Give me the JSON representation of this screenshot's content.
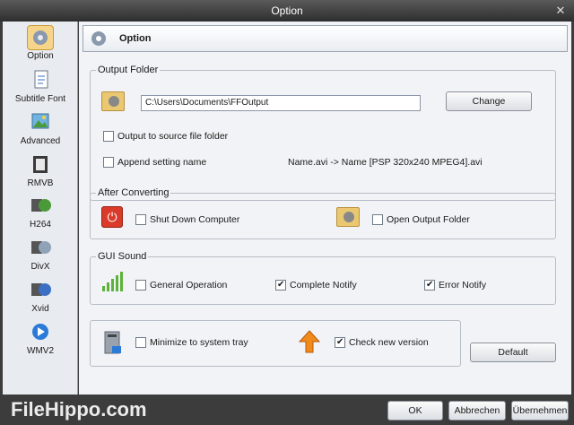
{
  "window": {
    "title": "Option",
    "close_glyph": "✕"
  },
  "sidebar": {
    "items": [
      {
        "label": "Option",
        "icon": "option-icon"
      },
      {
        "label": "Subtitle Font",
        "icon": "subtitle-font-icon"
      },
      {
        "label": "Advanced",
        "icon": "advanced-icon"
      },
      {
        "label": "RMVB",
        "icon": "rmvb-icon"
      },
      {
        "label": "H264",
        "icon": "h264-icon"
      },
      {
        "label": "DivX",
        "icon": "divx-icon"
      },
      {
        "label": "Xvid",
        "icon": "xvid-icon"
      },
      {
        "label": "WMV2",
        "icon": "wmv2-icon"
      }
    ]
  },
  "header": {
    "title": "Option"
  },
  "output_folder": {
    "label": "Output Folder",
    "path": "C:\\Users\\Documents\\FFOutput",
    "change_label": "Change",
    "to_source_label": "Output to source file folder",
    "to_source_checked": false,
    "append_label": "Append setting name",
    "append_checked": false,
    "append_example": "Name.avi  -> Name [PSP 320x240 MPEG4].avi"
  },
  "after_converting": {
    "label": "After Converting",
    "shutdown_label": "Shut Down Computer",
    "shutdown_checked": false,
    "open_folder_label": "Open Output Folder",
    "open_folder_checked": false
  },
  "gui_sound": {
    "label": "GUI Sound",
    "general_label": "General Operation",
    "general_checked": false,
    "complete_label": "Complete Notify",
    "complete_checked": true,
    "error_label": "Error Notify",
    "error_checked": true
  },
  "misc": {
    "minimize_label": "Minimize to system tray",
    "minimize_checked": false,
    "check_version_label": "Check new version",
    "check_version_checked": true,
    "default_label": "Default"
  },
  "footer": {
    "ok_label": "OK",
    "cancel_label": "Abbrechen",
    "apply_label": "Übernehmen",
    "watermark": "FileHippo.com"
  }
}
